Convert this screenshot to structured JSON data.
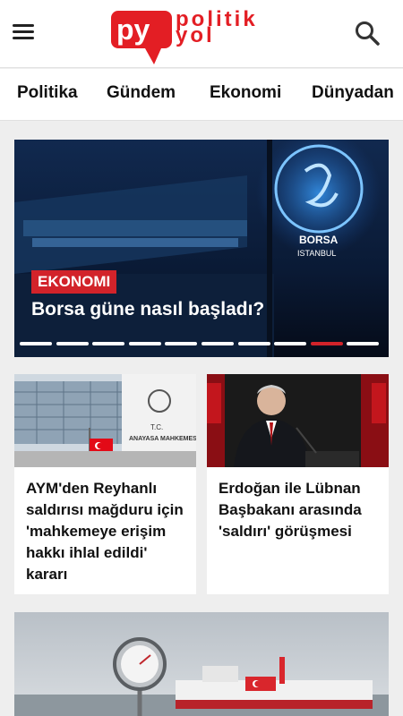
{
  "header": {
    "logo_line1": "politik",
    "logo_line2": "yol"
  },
  "nav": {
    "items": [
      {
        "label": "Politika"
      },
      {
        "label": "Gündem"
      },
      {
        "label": "Ekonomi"
      },
      {
        "label": "Dünyadan"
      }
    ]
  },
  "hero": {
    "category": "EKONOMI",
    "title": "Borsa güne nasıl başladı?",
    "screen_text_1": "BORSA",
    "screen_text_2": "ISTANBUL",
    "slides_total": 10,
    "active_slide": 9
  },
  "cards": [
    {
      "title": "AYM'den Reyhanlı saldırısı mağduru için 'mahkemeye erişim hakkı ihlal edildi' kararı",
      "sign_1": "T.C.",
      "sign_2": "ANAYASA MAHKEMESİ"
    },
    {
      "title": "Erdoğan ile Lübnan Başbakanı arasında 'saldırı' görüşmesi"
    }
  ],
  "colors": {
    "brand_red": "#e31e24",
    "accent_red": "#d2232a"
  },
  "icons": {
    "menu": "hamburger-icon",
    "search": "search-icon"
  }
}
